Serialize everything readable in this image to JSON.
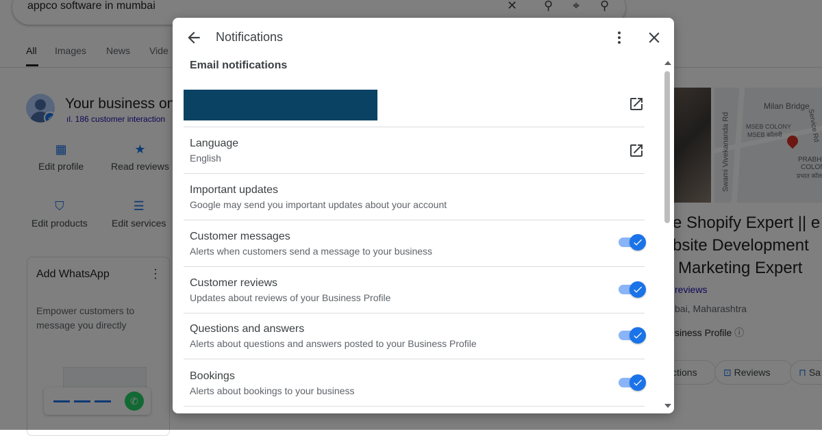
{
  "background": {
    "search_query": "appco software in mumbai",
    "tabs": [
      "All",
      "Images",
      "News",
      "Vide"
    ],
    "business_title": "Your business on",
    "business_sub": "186 customer interaction",
    "actions": [
      {
        "label": "Edit profile",
        "icon": "storefront-icon"
      },
      {
        "label": "Read reviews",
        "icon": "star-review-icon"
      },
      {
        "label": "Edit products",
        "icon": "shopping-bag-icon"
      },
      {
        "label": "Edit services",
        "icon": "list-icon"
      }
    ],
    "whatsapp_card": {
      "title": "Add WhatsApp",
      "description": "Empower customers to message you directly"
    },
    "map_labels": [
      "Milan Bridge",
      "MSEB COLONY",
      "MSEB कॉलनी",
      "Swami Vivekananda Rd",
      "Service Rd",
      "PRABHA",
      "COLONY",
      "प्रभात कॉल"
    ],
    "listing_title_lines": [
      "e Shopify Expert || e",
      "bsite Development",
      "Marketing Expert"
    ],
    "reviews_link": "reviews",
    "location": "bai, Maharashtra",
    "business_profile": "siness Profile",
    "chips": [
      "ctions",
      "Reviews",
      "Sa"
    ]
  },
  "dialog": {
    "title": "Notifications",
    "section_title": "Email notifications",
    "language": {
      "title": "Language",
      "value": "English"
    },
    "rows": [
      {
        "title": "Important updates",
        "subtitle": "Google may send you important updates about your account",
        "toggle": null
      },
      {
        "title": "Customer messages",
        "subtitle": "Alerts when customers send a message to your business",
        "toggle": true
      },
      {
        "title": "Customer reviews",
        "subtitle": "Updates about reviews of your Business Profile",
        "toggle": true
      },
      {
        "title": "Questions and answers",
        "subtitle": "Alerts about questions and answers posted to your Business Profile",
        "toggle": true
      },
      {
        "title": "Bookings",
        "subtitle": "Alerts about bookings to your business",
        "toggle": true
      }
    ],
    "colors": {
      "accent": "#1a73e8",
      "toggle_track": "#8ab4f8",
      "email_redaction": "#0a4264"
    }
  }
}
